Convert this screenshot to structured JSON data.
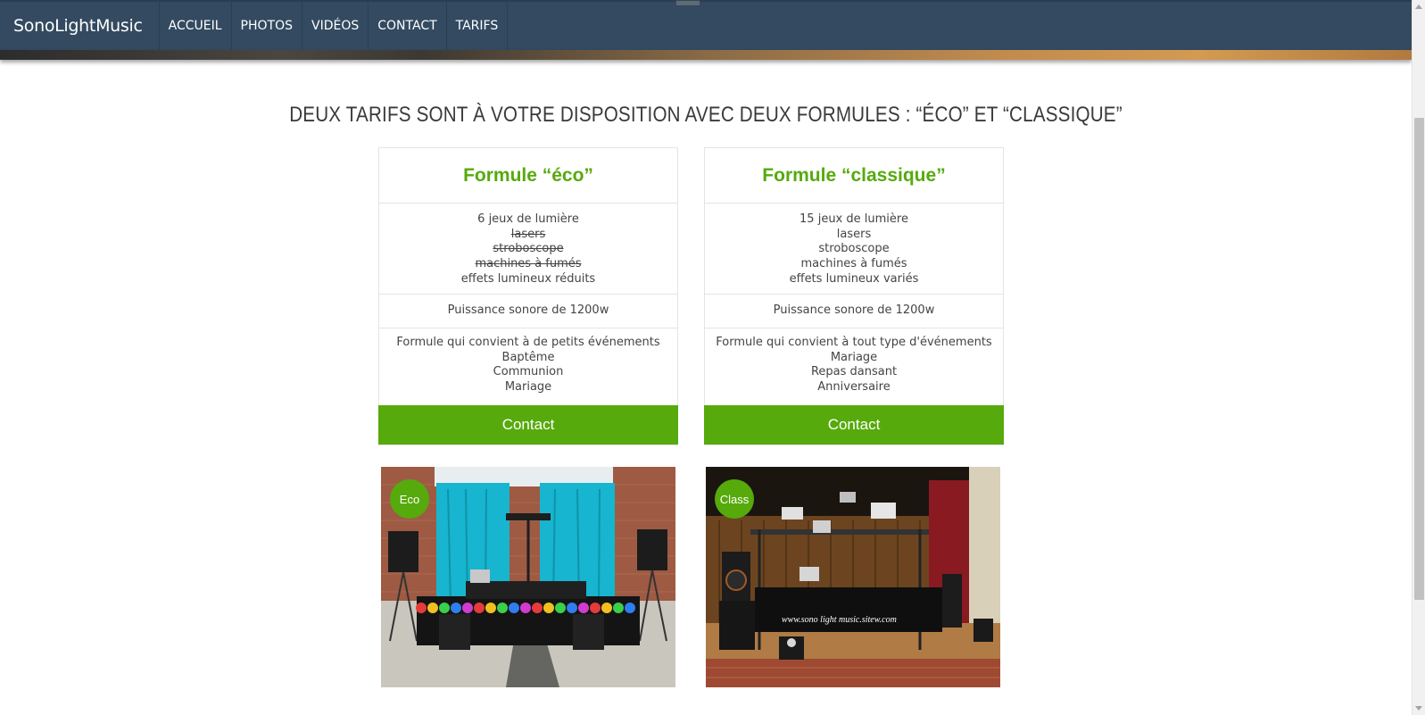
{
  "nav": {
    "brand": "SonoLightMusic",
    "items": [
      "ACCUEIL",
      "PHOTOS",
      "VIDÉOS",
      "CONTACT",
      "TARIFS"
    ]
  },
  "heading": "DEUX TARIFS SONT À VOTRE DISPOSITION AVEC DEUX FORMULES : “ÉCO” ET “CLASSIQUE”",
  "cards": [
    {
      "title": "Formule “éco”",
      "lights": [
        {
          "text": "6 jeux de lumière",
          "struck": false
        },
        {
          "text": "lasers",
          "struck": true
        },
        {
          "text": "stroboscope",
          "struck": true
        },
        {
          "text": "machines à fumés",
          "struck": true
        },
        {
          "text": "effets lumineux réduits",
          "struck": false
        }
      ],
      "power": "Puissance sonore de 1200w",
      "events": [
        "Formule qui convient à de petits événements",
        "Baptême",
        "Communion",
        "Mariage"
      ],
      "button": "Contact"
    },
    {
      "title": "Formule “classique”",
      "lights": [
        {
          "text": "15 jeux de lumière",
          "struck": false
        },
        {
          "text": "lasers",
          "struck": false
        },
        {
          "text": "stroboscope",
          "struck": false
        },
        {
          "text": "machines à fumés",
          "struck": false
        },
        {
          "text": "effets lumineux variés",
          "struck": false
        }
      ],
      "power": "Puissance sonore de 1200w",
      "events": [
        "Formule qui convient à tout type d'événements",
        "Mariage",
        "Repas dansant",
        "Anniversaire"
      ],
      "button": "Contact"
    }
  ],
  "photos": {
    "eco_badge": "Eco",
    "classic_badge": "Class",
    "watermark": "www.sono light music.sitew.com"
  },
  "colors": {
    "nav": "#334a60",
    "accent": "#56aa0c",
    "text": "#444444"
  }
}
